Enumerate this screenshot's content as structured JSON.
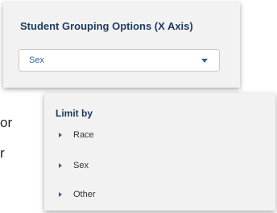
{
  "grouping_panel": {
    "title": "Student Grouping Options (X Axis)",
    "selected_value": "Sex",
    "caret_icon": "chevron-down-icon"
  },
  "background_text": {
    "line1": "or",
    "line2": "r"
  },
  "limit_panel": {
    "title": "Limit by",
    "items": [
      {
        "label": "Race",
        "icon": "caret-right-icon"
      },
      {
        "label": "Sex",
        "icon": "caret-right-icon"
      },
      {
        "label": "Other",
        "icon": "caret-right-icon"
      }
    ]
  },
  "colors": {
    "title": "#1e3a5f",
    "accent": "#2f5f9a",
    "panel_bg": "#f2f2f2"
  }
}
